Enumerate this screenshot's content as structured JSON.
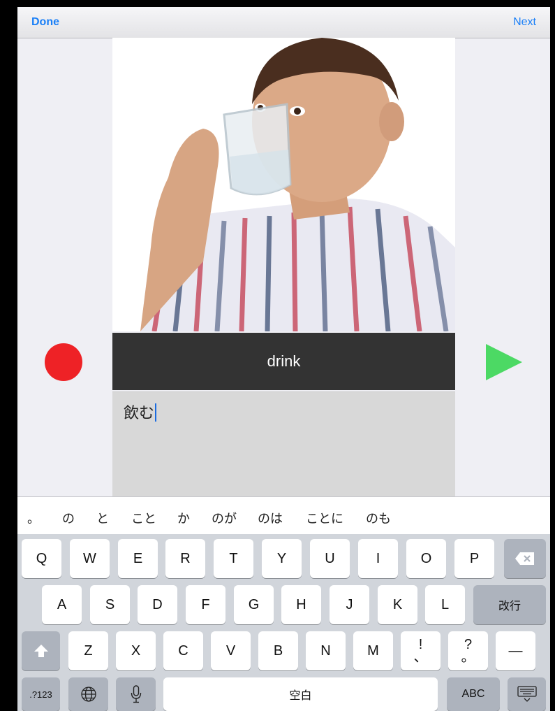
{
  "navbar": {
    "done_label": "Done",
    "next_label": "Next"
  },
  "card": {
    "word": "drink",
    "typed_text": "飲む"
  },
  "colors": {
    "record": "#ee2226",
    "play": "#4cd964",
    "link": "#1a7ff7"
  },
  "candidates": [
    "。",
    "の",
    "と",
    "こと",
    "か",
    "のが",
    "のは",
    "ことに",
    "のも"
  ],
  "keyboard": {
    "row1": [
      "Q",
      "W",
      "E",
      "R",
      "T",
      "Y",
      "U",
      "I",
      "O",
      "P"
    ],
    "row2": [
      "A",
      "S",
      "D",
      "F",
      "G",
      "H",
      "J",
      "K",
      "L"
    ],
    "return_label": "改行",
    "row3": [
      "Z",
      "X",
      "C",
      "V",
      "B",
      "N",
      "M"
    ],
    "punct1_top": "!",
    "punct1_bottom": "、",
    "punct2_top": "?",
    "punct2_bottom": "。",
    "dash": "—",
    "num_label": ".?123",
    "space_label": "空白",
    "abc_label": "ABC",
    "icons": [
      "delete-icon",
      "shift-icon",
      "globe-icon",
      "microphone-icon",
      "keyboard-hide-icon"
    ]
  }
}
